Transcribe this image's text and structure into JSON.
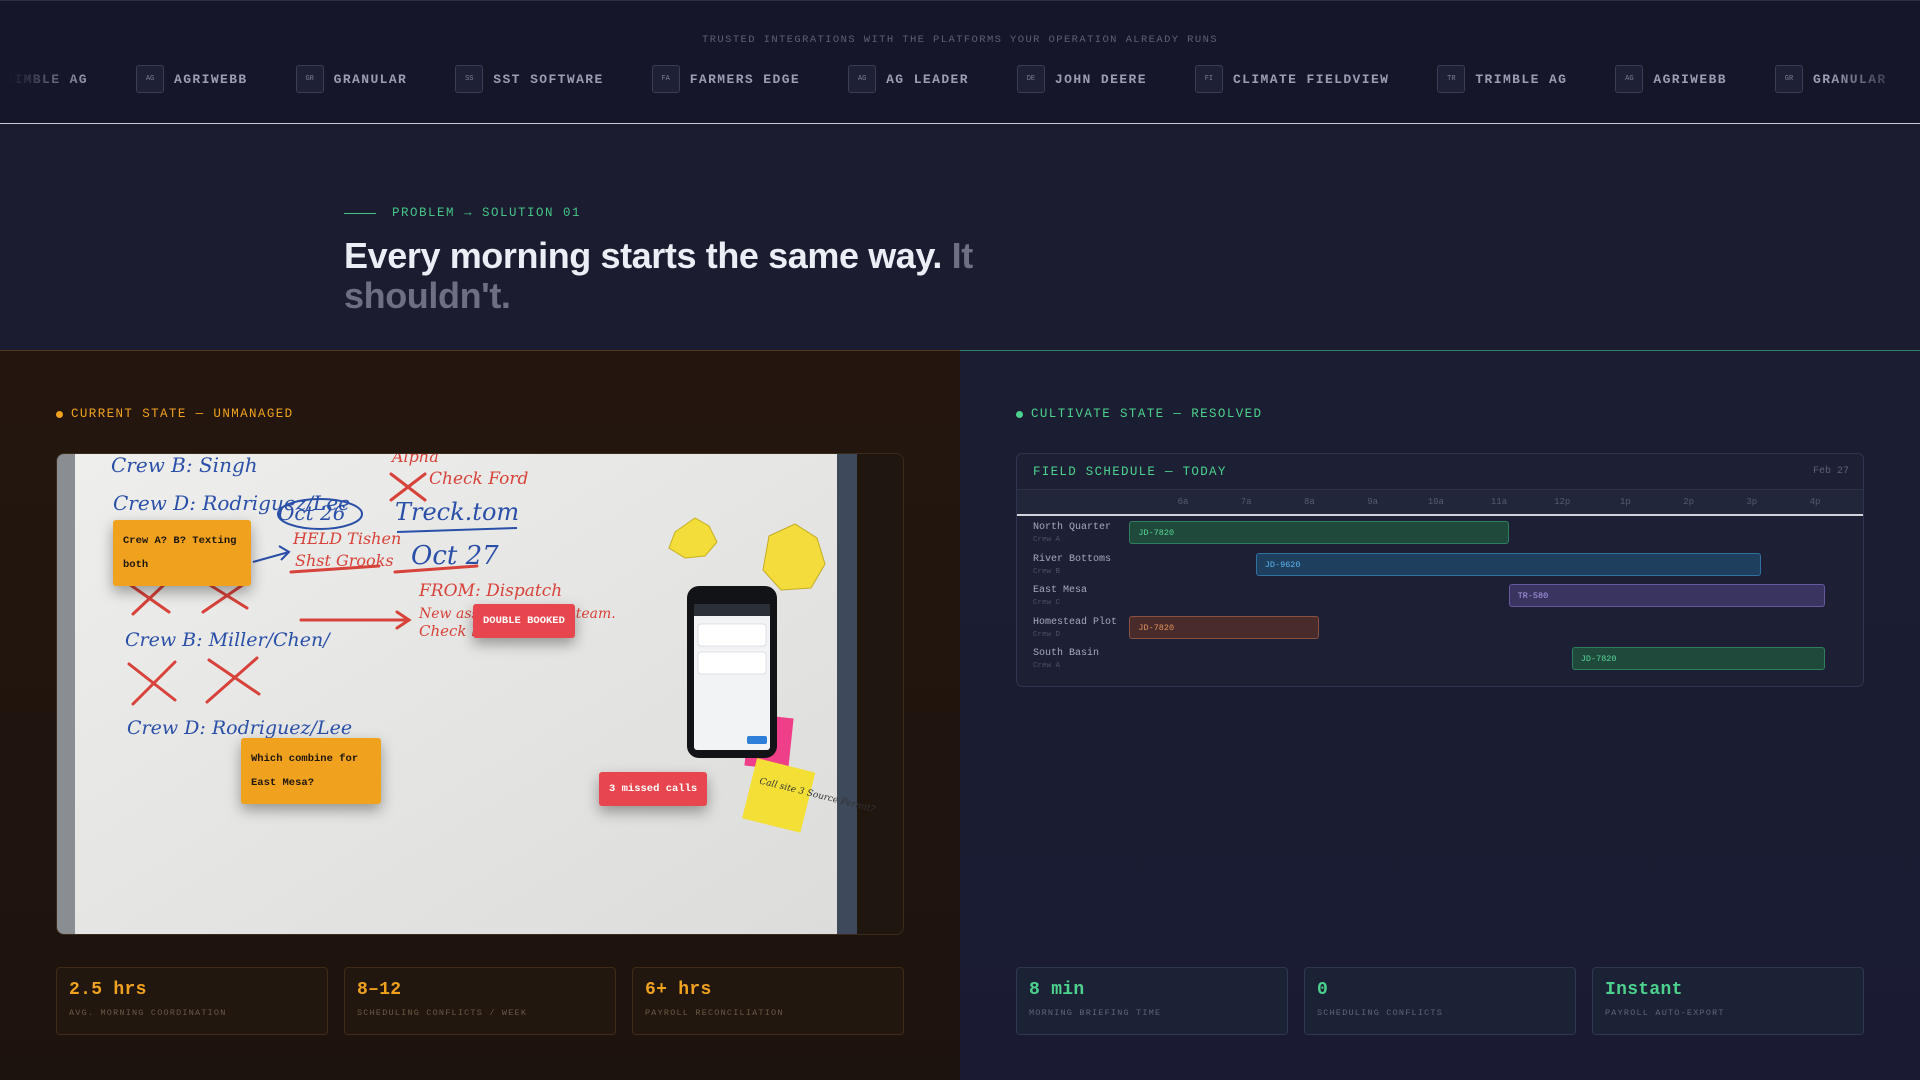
{
  "integrations": {
    "caption": "TRUSTED INTEGRATIONS WITH THE PLATFORMS YOUR OPERATION ALREADY RUNS",
    "logos": [
      {
        "badge": "TR",
        "name": "TRIMBLE AG"
      },
      {
        "badge": "AG",
        "name": "AGRIWEBB"
      },
      {
        "badge": "GR",
        "name": "GRANULAR"
      },
      {
        "badge": "SS",
        "name": "SST SOFTWARE"
      },
      {
        "badge": "FA",
        "name": "FARMERS EDGE"
      },
      {
        "badge": "AG",
        "name": "AG LEADER"
      },
      {
        "badge": "DE",
        "name": "JOHN DEERE"
      },
      {
        "badge": "FI",
        "name": "CLIMATE FIELDVIEW"
      },
      {
        "badge": "TR",
        "name": "TRIMBLE AG"
      },
      {
        "badge": "AG",
        "name": "AGRIWEBB"
      },
      {
        "badge": "GR",
        "name": "GRANULAR"
      },
      {
        "badge": "SS",
        "name": "SST SOFTWARE"
      }
    ]
  },
  "hero": {
    "eyebrow": "PROBLEM → SOLUTION 01",
    "headline_main": "Every morning starts the same way.",
    "headline_muted": "It shouldn't."
  },
  "current": {
    "label": "CURRENT STATE — UNMANAGED",
    "accent": "#f0a21e",
    "overlays": {
      "texting": "Crew A? B? Texting both",
      "double_booked": "DOUBLE BOOKED",
      "which_combine": "Which combine for East Mesa?",
      "missed_calls": "3 missed calls"
    },
    "board_text": {
      "crew_b_singh": "Crew B: Singh",
      "crew_d_rod1": "Crew D: Rodriguez/Lee",
      "oct26": "Oct 26",
      "held": "HELD Tishen",
      "shst": "Shst Grooks",
      "alpha": "Alpha",
      "check_ford": "Check Ford",
      "treck": "Treck.tom",
      "oct27": "Oct 27",
      "from_dispatch": "FROM: Dispatch",
      "new_assign": "New assign for Alpha team.",
      "check": "Check b",
      "crew_b_miller": "Crew B: Miller/Chen/",
      "crew_d_rod2": "Crew D: Rodriguez/Lee",
      "sticky_call": "Call site 3 Source Permit?"
    },
    "stats": [
      {
        "value": "2.5 hrs",
        "label": "AVG. MORNING COORDINATION"
      },
      {
        "value": "8–12",
        "label": "SCHEDULING CONFLICTS / WEEK"
      },
      {
        "value": "6+ hrs",
        "label": "PAYROLL RECONCILIATION"
      }
    ]
  },
  "resolved": {
    "label": "CULTIVATE STATE — RESOLVED",
    "accent": "#4cd28d",
    "schedule": {
      "title": "FIELD SCHEDULE — TODAY",
      "date": "Feb 27",
      "hours": [
        "6a",
        "7a",
        "8a",
        "9a",
        "10a",
        "11a",
        "12p",
        "1p",
        "2p",
        "3p",
        "4p"
      ],
      "rows": [
        {
          "field": "North Quarter",
          "crew": "Crew A",
          "equipment": "JD-7820",
          "start": 5.5,
          "end": 11.5,
          "color": "green"
        },
        {
          "field": "River Bottoms",
          "crew": "Crew B",
          "equipment": "JD-9620",
          "start": 7.5,
          "end": 15.5,
          "color": "blue"
        },
        {
          "field": "East Mesa",
          "crew": "Crew C",
          "equipment": "TR-580",
          "start": 11.5,
          "end": 16.5,
          "color": "purple"
        },
        {
          "field": "Homestead Plot",
          "crew": "Crew D",
          "equipment": "JD-7820",
          "start": 5.5,
          "end": 8.5,
          "color": "brown"
        },
        {
          "field": "South Basin",
          "crew": "Crew A",
          "equipment": "JD-7820",
          "start": 12.5,
          "end": 16.5,
          "color": "green"
        }
      ]
    },
    "stats": [
      {
        "value": "8 min",
        "label": "MORNING BRIEFING TIME"
      },
      {
        "value": "0",
        "label": "SCHEDULING CONFLICTS"
      },
      {
        "value": "Instant",
        "label": "PAYROLL AUTO-EXPORT"
      }
    ]
  }
}
